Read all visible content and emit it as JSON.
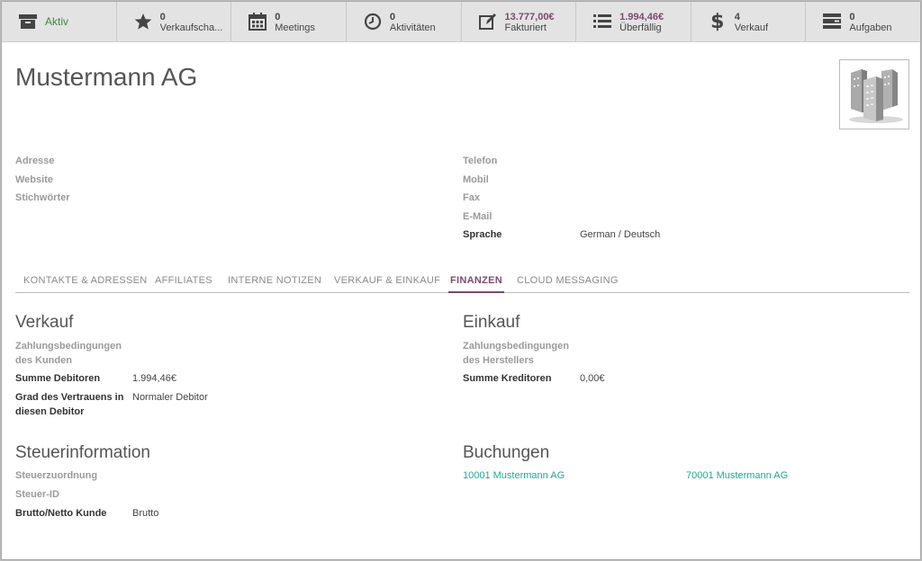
{
  "stat_buttons": [
    {
      "icon": "archive-icon",
      "value": "",
      "label": "Aktiv"
    },
    {
      "icon": "star-icon",
      "value": "0",
      "label": "Verkaufscha..."
    },
    {
      "icon": "calendar-icon",
      "value": "0",
      "label": "Meetings"
    },
    {
      "icon": "clock-icon",
      "value": "0",
      "label": "Aktivitäten"
    },
    {
      "icon": "edit-icon",
      "value": "13.777,00€",
      "label": "Fakturiert"
    },
    {
      "icon": "list-icon",
      "value": "1.994,46€",
      "label": "Überfällig"
    },
    {
      "icon": "dollar-icon",
      "value": "4",
      "label": "Verkauf"
    },
    {
      "icon": "tasks-icon",
      "value": "0",
      "label": "Aufgaben"
    }
  ],
  "partner": {
    "name": "Mustermann AG"
  },
  "fields_left": [
    {
      "label": "Adresse",
      "value": ""
    },
    {
      "label": "Website",
      "value": ""
    },
    {
      "label": "Stichwörter",
      "value": ""
    }
  ],
  "fields_right": [
    {
      "label": "Telefon",
      "value": ""
    },
    {
      "label": "Mobil",
      "value": ""
    },
    {
      "label": "Fax",
      "value": ""
    },
    {
      "label": "E-Mail",
      "value": ""
    },
    {
      "label": "Sprache",
      "value": "German / Deutsch"
    }
  ],
  "tabs": [
    "KONTAKTE & ADRESSEN",
    "AFFILIATES",
    "INTERNE NOTIZEN",
    "VERKAUF & EINKAUF",
    "FINANZEN",
    "CLOUD MESSAGING"
  ],
  "active_tab": "FINANZEN",
  "verkauf": {
    "heading": "Verkauf",
    "payment_terms_label": "Zahlungsbedingungen des Kunden",
    "receivable_label": "Summe Debitoren",
    "receivable_value": "1.994,46€",
    "trust_label": "Grad des Vertrauens in diesen Debitor",
    "trust_value": "Normaler Debitor"
  },
  "einkauf": {
    "heading": "Einkauf",
    "payment_terms_label": "Zahlungsbedingungen des Herstellers",
    "payable_label": "Summe Kreditoren",
    "payable_value": "0,00€"
  },
  "steuer": {
    "heading": "Steuerinformation",
    "fiscal_position_label": "Steuerzuordnung",
    "vat_label": "Steuer-ID",
    "tax_mode_label": "Brutto/Netto Kunde",
    "tax_mode_value": "Brutto"
  },
  "buchungen": {
    "heading": "Buchungen",
    "receivable_account": "10001 Mustermann AG",
    "payable_account": "70001 Mustermann AG"
  },
  "colors": {
    "accent": "#7c4a6e",
    "link": "#21a89a",
    "active_status": "#3a8a3a"
  }
}
